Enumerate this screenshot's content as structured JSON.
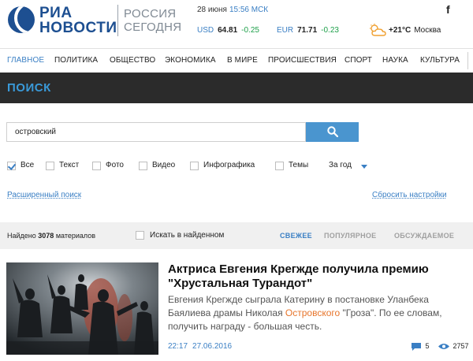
{
  "header": {
    "logo_line1": "РИА",
    "logo_line2": "НОВОСТИ",
    "logo_sub1": "РОССИЯ",
    "logo_sub2": "СЕГОДНЯ",
    "date": "28 июня",
    "time": "15:56 МСК",
    "usd_label": "USD",
    "usd_value": "64.81",
    "usd_change": "-0.25",
    "eur_label": "EUR",
    "eur_value": "71.71",
    "eur_change": "-0.23",
    "temperature": "+21°C",
    "city": "Москва",
    "social_label": "f"
  },
  "nav": {
    "items": [
      "ГЛАВНОЕ",
      "ПОЛИТИКА",
      "ОБЩЕСТВО",
      "ЭКОНОМИКА",
      "В МИРЕ",
      "ПРОИСШЕСТВИЯ",
      "СПОРТ",
      "НАУКА",
      "КУЛЬТУРА"
    ]
  },
  "search": {
    "title": "ПОИСК",
    "query": "островский",
    "filters": [
      {
        "label": "Все",
        "checked": true
      },
      {
        "label": "Текст",
        "checked": false
      },
      {
        "label": "Фото",
        "checked": false
      },
      {
        "label": "Видео",
        "checked": false
      },
      {
        "label": "Инфографика",
        "checked": false
      },
      {
        "label": "Темы",
        "checked": false
      }
    ],
    "period": "За год",
    "advanced_link": "Расширенный поиск",
    "reset_link": "Сбросить настройки"
  },
  "results": {
    "found_prefix": "Найдено",
    "found_count": "3078",
    "found_suffix": "материалов",
    "search_in_found": "Искать в найденном",
    "sort_new": "СВЕЖЕЕ",
    "sort_popular": "ПОПУЛЯРНОЕ",
    "sort_discussed": "ОБСУЖДАЕМОЕ"
  },
  "article": {
    "title": "Актриса Евгения Крегжде получила премию \"Хрустальная Турандот\"",
    "lead_part1": "Евгения Крегжде сыграла Катерину в постановке Уланбека Баялиева драмы Николая ",
    "lead_highlight": "Островского",
    "lead_part2": " \"Гроза\". По ее словам, получить награду - большая честь.",
    "time": "22:17",
    "date": "27.06.2016",
    "comments": "5",
    "views": "2757"
  },
  "colors": {
    "accent": "#3a7fc4",
    "title_bar": "#2b2b2b",
    "highlight": "#e7752b",
    "positive": "#1ea04a"
  }
}
